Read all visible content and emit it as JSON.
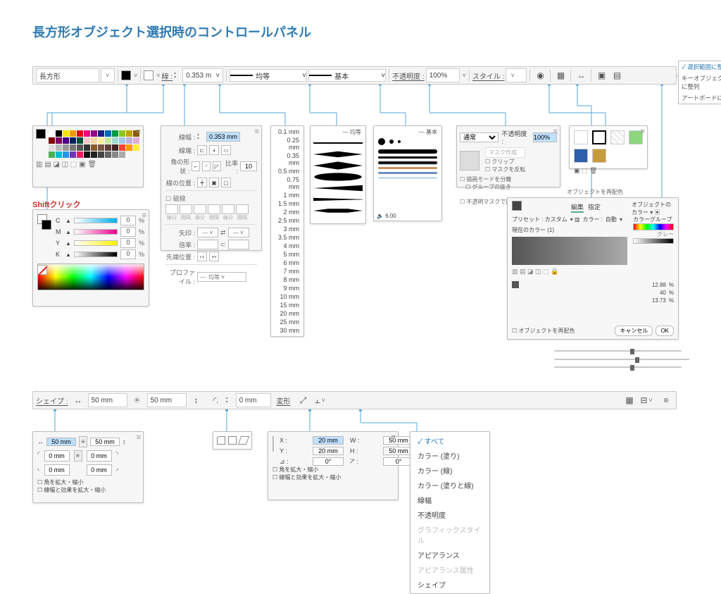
{
  "title": "長方形オブジェクト選択時のコントロールパネル",
  "topbar": {
    "obj_type": "長方形",
    "stroke_label": "線 :",
    "stroke_width": "0.353 m",
    "profile_label": "均等",
    "brush_label": "基本",
    "opacity_label_u": "不透明度 :",
    "opacity_value": "100%",
    "style_label_u": "スタイル :"
  },
  "align_to_menu": {
    "items": [
      {
        "label": "選択範囲に整列",
        "selected": true
      },
      {
        "label": "キーオブジェクトに整列",
        "selected": false
      },
      {
        "label": "アートボードに整列",
        "selected": false
      }
    ]
  },
  "swatch_colors": [
    "#ffffff",
    "#000000",
    "#f6e200",
    "#f39800",
    "#e60012",
    "#e4007f",
    "#920783",
    "#1d2088",
    "#0068b7",
    "#009944",
    "#8fc31f",
    "#c0a300",
    "#8a5a00",
    "#7e0000",
    "#7d005f",
    "#4b0082",
    "#001e5a",
    "#004d3a",
    "#f5c6c6",
    "#f3d6a3",
    "#f7ee9e",
    "#c9e6a3",
    "#a3d9d0",
    "#a3c8e6",
    "#c0b0e0",
    "#e0b0d0",
    "#dddddd",
    "#bbbbbb",
    "#999999",
    "#777777",
    "#555555",
    "#333333",
    "#8b5a2b",
    "#795548",
    "#5d4037",
    "#3e2723",
    "#f44336",
    "#ff9800",
    "#ffeb3b",
    "#4caf50",
    "#00bcd4",
    "#2196f3",
    "#673ab7",
    "#e91e63",
    "#111111",
    "#222222",
    "#444444",
    "#666666",
    "#888888",
    "#aaaaaa"
  ],
  "cmyk_title": "Shiftクリック",
  "cmyk": {
    "channels": [
      {
        "name": "C",
        "value": "0",
        "grad": "linear-gradient(to right,#fff,#00aeef)"
      },
      {
        "name": "M",
        "value": "0",
        "grad": "linear-gradient(to right,#fff,#ec008c)"
      },
      {
        "name": "Y",
        "value": "0",
        "grad": "linear-gradient(to right,#fff,#fff200)"
      },
      {
        "name": "K",
        "value": "0",
        "grad": "linear-gradient(to right,#fff,#000)"
      }
    ]
  },
  "stroke_panel": {
    "width_label": "線幅 :",
    "width_value": "0.353 mm",
    "cap_label": "線端 :",
    "corner_label": "角の形状 :",
    "limit_label": "比率 :",
    "limit_value": "10",
    "align_label": "線の位置 :",
    "dashed_label": "破線",
    "dash_headers": [
      "線分",
      "間隔",
      "線分",
      "間隔",
      "線分",
      "間隔"
    ],
    "arrow_label": "矢印 :",
    "scale_label": "倍率 :",
    "arrow_align_label": "先端位置 :",
    "profile_label": "プロファイル :",
    "profile_value": "均等"
  },
  "stroke_widths": [
    "0.1 mm",
    "0.25 mm",
    "0.35 mm",
    "0.5 mm",
    "0.75 mm",
    "1 mm",
    "1.5 mm",
    "2 mm",
    "2.5 mm",
    "3 mm",
    "3.5 mm",
    "4 mm",
    "5 mm",
    "6 mm",
    "7 mm",
    "8 mm",
    "9 mm",
    "10 mm",
    "15 mm",
    "20 mm",
    "25 mm",
    "30 mm"
  ],
  "profile_hdr": "均等",
  "brush_hdr": "基本",
  "brush_vol": "6.00",
  "opacity": {
    "blend_value": "通常",
    "label": "不透明度 :",
    "value": "100%",
    "mask_make": "マスク作成",
    "clip": "クリップ",
    "invert": "マスクを反転",
    "iso": "描画モードを分離",
    "knock": "グループの抜き",
    "define": "不透明マスクで形状の抜きを定義"
  },
  "recolor": {
    "header": "オブジェクトを再配色",
    "tabs": [
      "編集",
      "指定"
    ],
    "preset_label": "プリセット : カスタム",
    "colors_label": "カラー :",
    "colors_value": "自動",
    "curcol_label": "現在のカラー (1)",
    "group_label": "カラーグループ",
    "gray_label": "グレー",
    "colorlib_label": "オブジェクトのカラー",
    "s1": "12.88",
    "s2": "40",
    "s3": "13.73",
    "u1": "%",
    "u2": "%",
    "u3": "%",
    "recolor_check": "オブジェクトを再配色",
    "cancel": "キャンセル",
    "ok": "OK"
  },
  "bar2": {
    "shape_label": "シェイプ :",
    "w": "50 mm",
    "h": "50 mm",
    "corner": "0 mm",
    "transform_label": "変形"
  },
  "size_panel": {
    "w": "50 mm",
    "h": "50 mm",
    "r1": "0 mm",
    "r2": "0 mm",
    "r3": "0 mm",
    "r4": "0 mm",
    "chk1": "角を拡大・縮小",
    "chk2": "線幅と効果を拡大・縮小"
  },
  "xform": {
    "x_label": "X :",
    "x": "20 mm",
    "y_label": "Y :",
    "y": "20 mm",
    "w_label": "W :",
    "w": "50 mm",
    "h_label": "H :",
    "h": "50 mm",
    "ang_label": "⊿ :",
    "ang": "0°",
    "shear_label": "⦢ :",
    "shear": "0°",
    "chk1": "角を拡大・縮小",
    "chk2": "線幅と効果を拡大・縮小"
  },
  "xmenu": {
    "items": [
      {
        "label": "すべて",
        "state": "sel"
      },
      {
        "label": "カラー (塗り)",
        "state": ""
      },
      {
        "label": "カラー (線)",
        "state": ""
      },
      {
        "label": "カラー (塗りと線)",
        "state": ""
      },
      {
        "label": "線幅",
        "state": ""
      },
      {
        "label": "不透明度",
        "state": ""
      },
      {
        "label": "グラフィックスタイル",
        "state": "dis"
      },
      {
        "label": "アピアランス",
        "state": ""
      },
      {
        "label": "アピアランス属性",
        "state": "dis"
      },
      {
        "label": "シェイプ",
        "state": ""
      }
    ]
  }
}
